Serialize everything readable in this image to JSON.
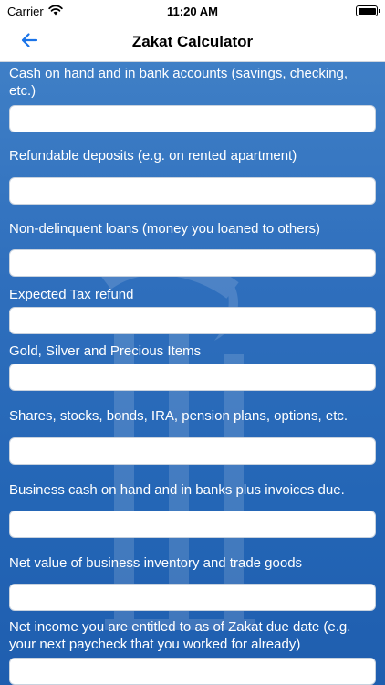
{
  "status_bar": {
    "carrier": "Carrier",
    "time": "11:20 AM"
  },
  "nav": {
    "title": "Zakat Calculator",
    "back_icon": "arrow-left-icon",
    "accent_color": "#1a73e8"
  },
  "background_color": "#2f6fbd",
  "fields": [
    {
      "label": "Cash on hand and in bank accounts (savings, checking, etc.)",
      "value": ""
    },
    {
      "label": "Refundable deposits (e.g. on rented apartment)",
      "value": ""
    },
    {
      "label": "Non-delinquent loans (money you loaned to others)",
      "value": ""
    },
    {
      "label": "Expected Tax refund",
      "value": ""
    },
    {
      "label": "Gold, Silver and Precious Items",
      "value": ""
    },
    {
      "label": "Shares, stocks, bonds, IRA, pension plans, options, etc.",
      "value": ""
    },
    {
      "label": "Business cash on hand and in banks plus invoices due.",
      "value": ""
    },
    {
      "label": "Net value of business inventory and trade goods",
      "value": ""
    },
    {
      "label": "Net income you are entitled to as of Zakat due date (e.g. your next paycheck that you worked for already)",
      "value": ""
    }
  ]
}
